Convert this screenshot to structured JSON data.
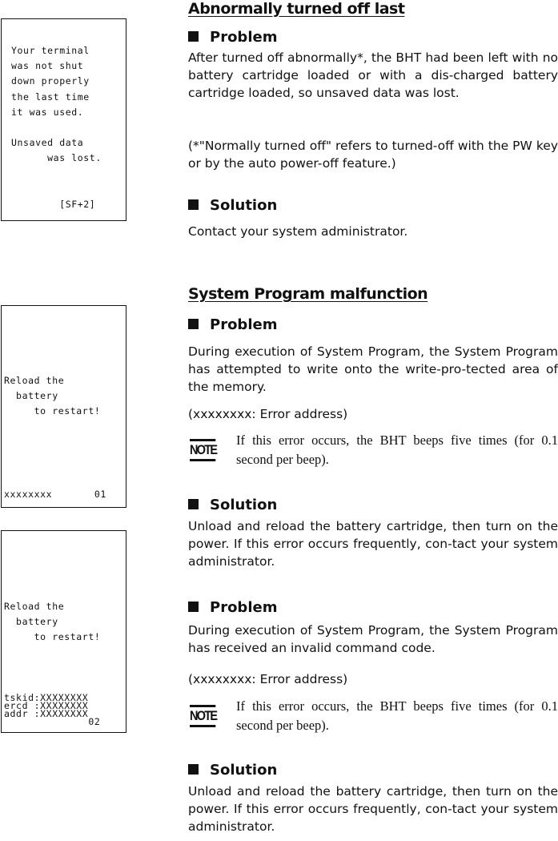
{
  "section1": {
    "title": "Abnormally turned off last",
    "problem_label": "Problem",
    "problem_text": "After turned off abnormally*, the BHT had been left with no battery cartridge loaded or with a dis-charged battery cartridge loaded, so unsaved data was lost.",
    "footnote": "(*\"Normally turned off\" refers to turned-off with the PW  key or by the auto power-off feature.)",
    "solution_label": "Solution",
    "solution_text": "Contact your system administrator.",
    "screen": [
      "Your terminal",
      "was not shut",
      "down properly",
      "the last time",
      "it was used.",
      "",
      "Unsaved data",
      "      was lost.",
      "",
      "",
      "        [SF+2]"
    ]
  },
  "section2": {
    "title": "System Program malfunction",
    "problem1_label": "Problem",
    "problem1_text": "During execution of System Program, the System Program has attempted to write onto the write-pro-tected area of the memory.",
    "address1": "(xxxxxxxx:  Error address)",
    "note_label": "NOTE",
    "note1": "If this error occurs, the BHT beeps five times (for 0.1 second per beep).",
    "solution1_label": "Solution",
    "solution1_text": "Unload and reload the battery cartridge, then turn on the power.  If this error occurs frequently, con-tact your system administrator.",
    "problem2_label": "Problem",
    "problem2_text": "During execution of System Program, the System Program has received an invalid command code.",
    "address2": "(xxxxxxxx:  Error address)",
    "note2": "If this error occurs, the BHT beeps five times (for 0.1 second per beep).",
    "solution2_label": "Solution",
    "solution2_text": "Unload and reload the battery cartridge, then turn on the power.  If this error occurs frequently, con-tact your system administrator.",
    "screen1": {
      "l1": "Reload the",
      "l2": "  battery",
      "l3": "     to restart!",
      "bottom": "xxxxxxxx       01"
    },
    "screen2": {
      "l1": "Reload the",
      "l2": "  battery",
      "l3": "     to restart!",
      "b1": "tskid:XXXXXXXX",
      "b2": "ercd :XXXXXXXX",
      "b3": "addr :XXXXXXXX",
      "b4": "              02"
    }
  }
}
